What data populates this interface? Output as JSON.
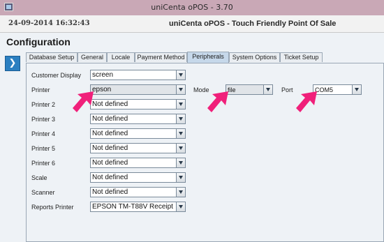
{
  "window": {
    "title": "uniCenta oPOS - 3.70"
  },
  "header": {
    "datetime": "24-09-2014 16:32:43",
    "app_name": "uniCenta oPOS - Touch Friendly Point Of Sale"
  },
  "page": {
    "title": "Configuration"
  },
  "tabs": [
    {
      "label": "Database Setup",
      "active": false
    },
    {
      "label": "General",
      "active": false
    },
    {
      "label": "Locale",
      "active": false
    },
    {
      "label": "Payment Method",
      "active": false
    },
    {
      "label": "Peripherals",
      "active": true
    },
    {
      "label": "System Options",
      "active": false
    },
    {
      "label": "Ticket Setup",
      "active": false
    }
  ],
  "peripherals": {
    "customer_display": {
      "label": "Customer Display",
      "value": "screen"
    },
    "printer": {
      "label": "Printer",
      "value": "epson",
      "mode_label": "Mode",
      "mode_value": "file",
      "port_label": "Port",
      "port_value": "COM5"
    },
    "printer_2": {
      "label": "Printer 2",
      "value": "Not defined"
    },
    "printer_3": {
      "label": "Printer 3",
      "value": "Not defined"
    },
    "printer_4": {
      "label": "Printer 4",
      "value": "Not defined"
    },
    "printer_5": {
      "label": "Printer 5",
      "value": "Not defined"
    },
    "printer_6": {
      "label": "Printer 6",
      "value": "Not defined"
    },
    "scale": {
      "label": "Scale",
      "value": "Not defined"
    },
    "scanner": {
      "label": "Scanner",
      "value": "Not defined"
    },
    "reports_printer": {
      "label": "Reports Printer",
      "value": "EPSON TM-T88V Receipt"
    }
  },
  "colors": {
    "annotation_arrow": "#f0207a",
    "active_tab": "#c6d8ea",
    "side_button": "#2b7fc1"
  },
  "icons": {
    "side_button": "collapse-sidebar-icon",
    "app": "app-icon",
    "annotation": "pointer-arrow-icon"
  }
}
